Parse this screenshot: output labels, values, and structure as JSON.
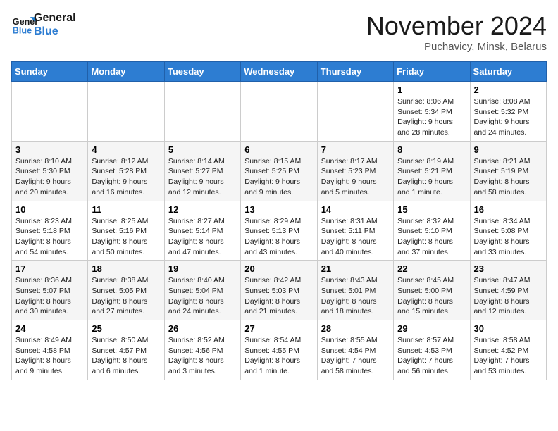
{
  "header": {
    "logo_line1": "General",
    "logo_line2": "Blue",
    "month_title": "November 2024",
    "location": "Puchavicy, Minsk, Belarus"
  },
  "weekdays": [
    "Sunday",
    "Monday",
    "Tuesday",
    "Wednesday",
    "Thursday",
    "Friday",
    "Saturday"
  ],
  "weeks": [
    [
      {
        "day": "",
        "info": ""
      },
      {
        "day": "",
        "info": ""
      },
      {
        "day": "",
        "info": ""
      },
      {
        "day": "",
        "info": ""
      },
      {
        "day": "",
        "info": ""
      },
      {
        "day": "1",
        "info": "Sunrise: 8:06 AM\nSunset: 5:34 PM\nDaylight: 9 hours and 28 minutes."
      },
      {
        "day": "2",
        "info": "Sunrise: 8:08 AM\nSunset: 5:32 PM\nDaylight: 9 hours and 24 minutes."
      }
    ],
    [
      {
        "day": "3",
        "info": "Sunrise: 8:10 AM\nSunset: 5:30 PM\nDaylight: 9 hours and 20 minutes."
      },
      {
        "day": "4",
        "info": "Sunrise: 8:12 AM\nSunset: 5:28 PM\nDaylight: 9 hours and 16 minutes."
      },
      {
        "day": "5",
        "info": "Sunrise: 8:14 AM\nSunset: 5:27 PM\nDaylight: 9 hours and 12 minutes."
      },
      {
        "day": "6",
        "info": "Sunrise: 8:15 AM\nSunset: 5:25 PM\nDaylight: 9 hours and 9 minutes."
      },
      {
        "day": "7",
        "info": "Sunrise: 8:17 AM\nSunset: 5:23 PM\nDaylight: 9 hours and 5 minutes."
      },
      {
        "day": "8",
        "info": "Sunrise: 8:19 AM\nSunset: 5:21 PM\nDaylight: 9 hours and 1 minute."
      },
      {
        "day": "9",
        "info": "Sunrise: 8:21 AM\nSunset: 5:19 PM\nDaylight: 8 hours and 58 minutes."
      }
    ],
    [
      {
        "day": "10",
        "info": "Sunrise: 8:23 AM\nSunset: 5:18 PM\nDaylight: 8 hours and 54 minutes."
      },
      {
        "day": "11",
        "info": "Sunrise: 8:25 AM\nSunset: 5:16 PM\nDaylight: 8 hours and 50 minutes."
      },
      {
        "day": "12",
        "info": "Sunrise: 8:27 AM\nSunset: 5:14 PM\nDaylight: 8 hours and 47 minutes."
      },
      {
        "day": "13",
        "info": "Sunrise: 8:29 AM\nSunset: 5:13 PM\nDaylight: 8 hours and 43 minutes."
      },
      {
        "day": "14",
        "info": "Sunrise: 8:31 AM\nSunset: 5:11 PM\nDaylight: 8 hours and 40 minutes."
      },
      {
        "day": "15",
        "info": "Sunrise: 8:32 AM\nSunset: 5:10 PM\nDaylight: 8 hours and 37 minutes."
      },
      {
        "day": "16",
        "info": "Sunrise: 8:34 AM\nSunset: 5:08 PM\nDaylight: 8 hours and 33 minutes."
      }
    ],
    [
      {
        "day": "17",
        "info": "Sunrise: 8:36 AM\nSunset: 5:07 PM\nDaylight: 8 hours and 30 minutes."
      },
      {
        "day": "18",
        "info": "Sunrise: 8:38 AM\nSunset: 5:05 PM\nDaylight: 8 hours and 27 minutes."
      },
      {
        "day": "19",
        "info": "Sunrise: 8:40 AM\nSunset: 5:04 PM\nDaylight: 8 hours and 24 minutes."
      },
      {
        "day": "20",
        "info": "Sunrise: 8:42 AM\nSunset: 5:03 PM\nDaylight: 8 hours and 21 minutes."
      },
      {
        "day": "21",
        "info": "Sunrise: 8:43 AM\nSunset: 5:01 PM\nDaylight: 8 hours and 18 minutes."
      },
      {
        "day": "22",
        "info": "Sunrise: 8:45 AM\nSunset: 5:00 PM\nDaylight: 8 hours and 15 minutes."
      },
      {
        "day": "23",
        "info": "Sunrise: 8:47 AM\nSunset: 4:59 PM\nDaylight: 8 hours and 12 minutes."
      }
    ],
    [
      {
        "day": "24",
        "info": "Sunrise: 8:49 AM\nSunset: 4:58 PM\nDaylight: 8 hours and 9 minutes."
      },
      {
        "day": "25",
        "info": "Sunrise: 8:50 AM\nSunset: 4:57 PM\nDaylight: 8 hours and 6 minutes."
      },
      {
        "day": "26",
        "info": "Sunrise: 8:52 AM\nSunset: 4:56 PM\nDaylight: 8 hours and 3 minutes."
      },
      {
        "day": "27",
        "info": "Sunrise: 8:54 AM\nSunset: 4:55 PM\nDaylight: 8 hours and 1 minute."
      },
      {
        "day": "28",
        "info": "Sunrise: 8:55 AM\nSunset: 4:54 PM\nDaylight: 7 hours and 58 minutes."
      },
      {
        "day": "29",
        "info": "Sunrise: 8:57 AM\nSunset: 4:53 PM\nDaylight: 7 hours and 56 minutes."
      },
      {
        "day": "30",
        "info": "Sunrise: 8:58 AM\nSunset: 4:52 PM\nDaylight: 7 hours and 53 minutes."
      }
    ]
  ]
}
